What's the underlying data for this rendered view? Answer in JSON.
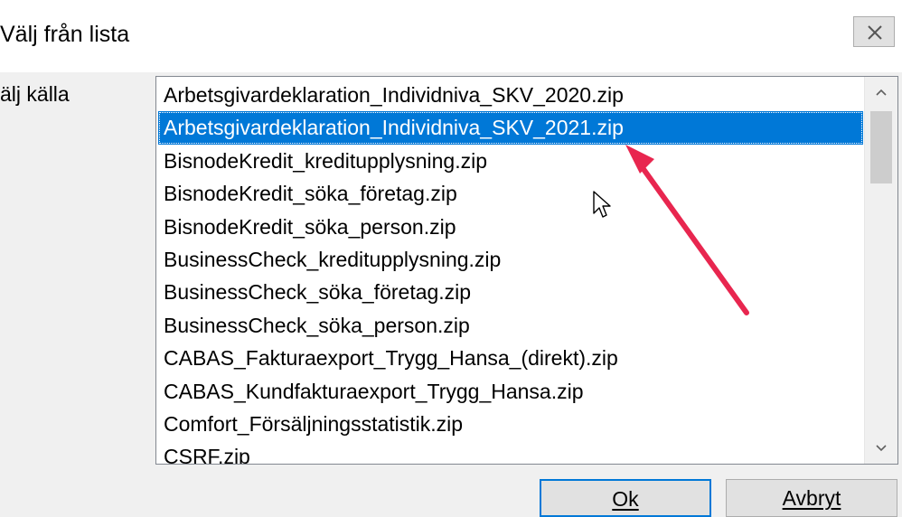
{
  "window": {
    "title": "Välj från lista",
    "close_icon": "close-icon"
  },
  "form": {
    "source_label": "älj källa"
  },
  "list": {
    "selected_index": 1,
    "items": [
      "Arbetsgivardeklaration_Individniva_SKV_2020.zip",
      "Arbetsgivardeklaration_Individniva_SKV_2021.zip",
      "BisnodeKredit_kreditupplysning.zip",
      "BisnodeKredit_söka_företag.zip",
      "BisnodeKredit_söka_person.zip",
      "BusinessCheck_kreditupplysning.zip",
      "BusinessCheck_söka_företag.zip",
      "BusinessCheck_söka_person.zip",
      "CABAS_Fakturaexport_Trygg_Hansa_(direkt).zip",
      "CABAS_Kundfakturaexport_Trygg_Hansa.zip",
      "Comfort_Försäljningsstatistik.zip",
      "CSRF.zip"
    ]
  },
  "buttons": {
    "ok_label": "Ok",
    "cancel_label": "Avbryt"
  },
  "colors": {
    "selection": "#0078d7",
    "annotation_arrow": "#e8264f"
  }
}
